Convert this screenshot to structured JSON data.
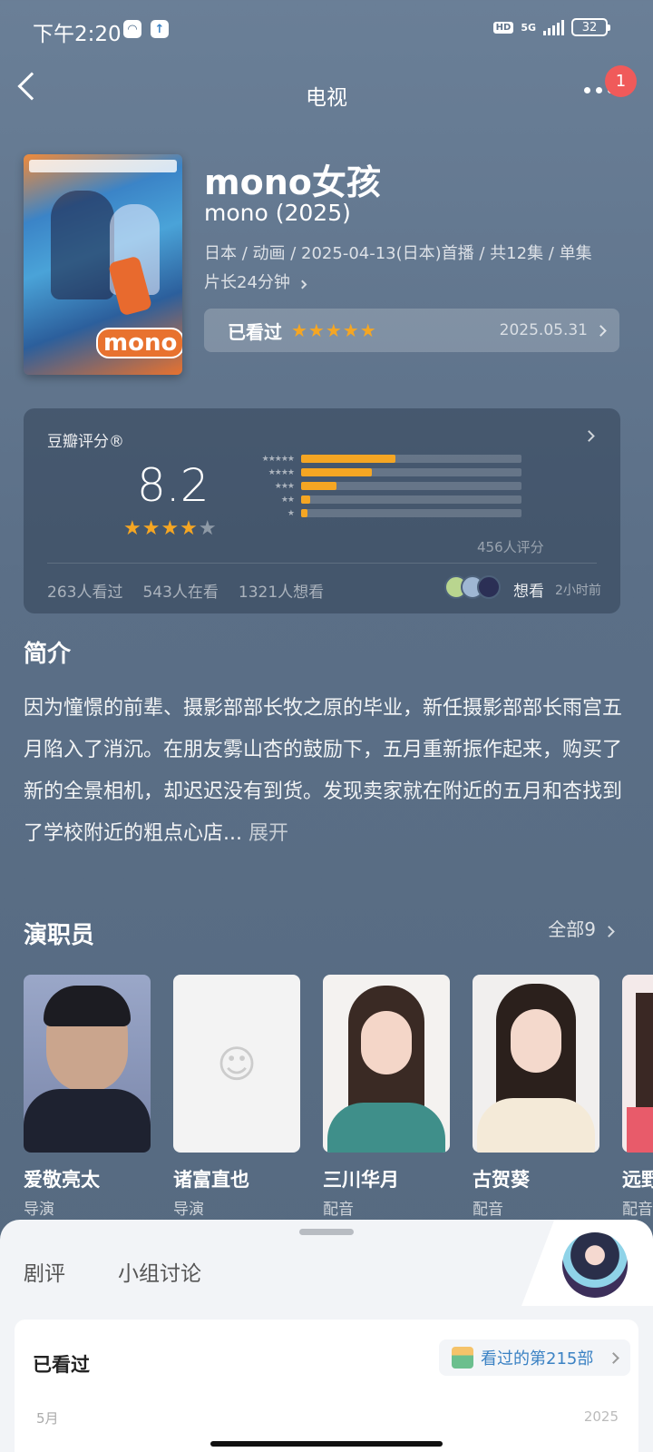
{
  "status_bar": {
    "time": "下午2:20",
    "network": "5G",
    "hd": "HD",
    "battery": "32"
  },
  "nav": {
    "title": "电视",
    "notification_count": "1"
  },
  "movie": {
    "poster_logo": "mono",
    "title": "mono女孩",
    "original_title": "mono (2025)",
    "meta_line1": "日本 / 动画 / 2025-04-13(日本)首播 / 共12集 / 单集",
    "meta_line2": "片长24分钟",
    "watched_label": "已看过",
    "my_rating_stars": "★★★★★",
    "watched_date": "2025.05.31"
  },
  "rating": {
    "label": "豆瓣评分®",
    "score": "8.2",
    "stars_on": "★★★★",
    "stars_off": "★",
    "count_text": "456人评分",
    "distribution": [
      {
        "stars": "★★★★★",
        "percent": 43
      },
      {
        "stars": "★★★★",
        "percent": 32
      },
      {
        "stars": "★★★",
        "percent": 16
      },
      {
        "stars": "★★",
        "percent": 4
      },
      {
        "stars": "★",
        "percent": 3
      }
    ],
    "watched": "263人看过",
    "watching": "543人在看",
    "want": "1321人想看",
    "friend_action": "想看",
    "friend_time": "2小时前"
  },
  "synopsis": {
    "heading": "简介",
    "text": "因为憧憬的前辈、摄影部部长牧之原的毕业，新任摄影部部长雨宫五月陷入了消沉。在朋友雾山杏的鼓励下，五月重新振作起来，购买了新的全景相机，却迟迟没有到货。发现卖家就在附近的五月和杏找到了学校附近的粗点心店...",
    "expand": "展开"
  },
  "cast": {
    "heading": "演职员",
    "all_label": "全部9",
    "members": [
      {
        "name": "爱敬亮太",
        "role": "导演"
      },
      {
        "name": "诸富直也",
        "role": "导演"
      },
      {
        "name": "三川华月",
        "role": "配音"
      },
      {
        "name": "古贺葵",
        "role": "配音"
      },
      {
        "name": "远野",
        "role": "配音"
      }
    ]
  },
  "sheet": {
    "tabs": [
      "剧评",
      "小组讨论"
    ],
    "card_title": "已看过",
    "badge_text": "看过的第215部",
    "month": "5月",
    "year": "2025"
  },
  "colors": {
    "accent_star": "#f5a623",
    "badge_red": "#f05a5a",
    "link_blue": "#3b82c4"
  }
}
